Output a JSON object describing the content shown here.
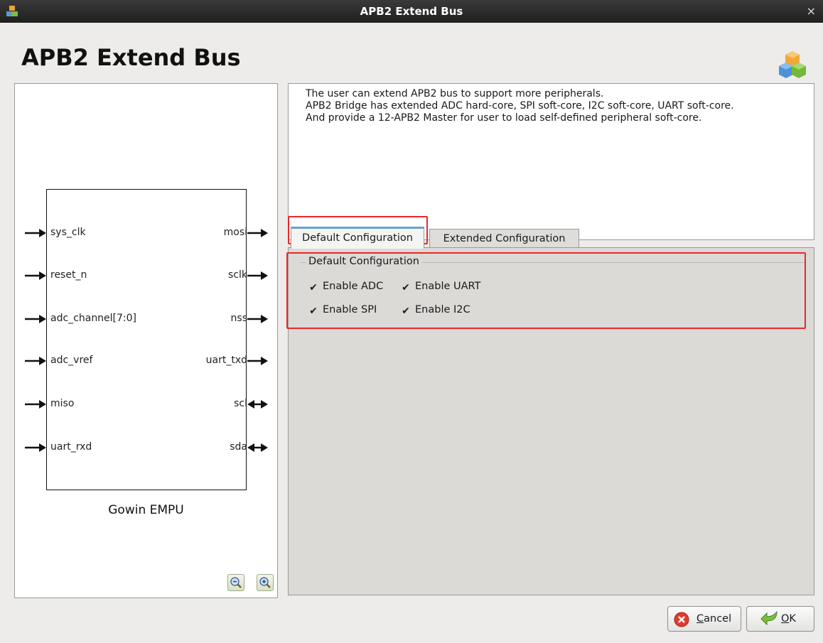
{
  "window": {
    "title": "APB2 Extend Bus",
    "close_glyph": "×"
  },
  "header": {
    "title": "APB2 Extend Bus"
  },
  "diagram": {
    "block_label": "Gowin EMPU",
    "inputs": [
      "sys_clk",
      "reset_n",
      "adc_channel[7:0]",
      "adc_vref",
      "miso",
      "uart_rxd"
    ],
    "outputs": [
      "mosi",
      "sclk",
      "nss",
      "uart_txd",
      "scl",
      "sda"
    ],
    "zoom_out_icon": "zoom-out-icon",
    "zoom_in_icon": "zoom-in-icon"
  },
  "description": {
    "lines": [
      "The user can extend APB2 bus to support more peripherals.",
      "APB2 Bridge has extended ADC hard-core, SPI soft-core, I2C soft-core, UART soft-core.",
      "And provide a 12-APB2 Master for user to load self-defined peripheral soft-core."
    ]
  },
  "tabs": {
    "default": "Default Configuration",
    "extended": "Extended Configuration"
  },
  "config": {
    "group_label": "Default Configuration",
    "options": [
      {
        "label": "Enable ADC",
        "checked": true
      },
      {
        "label": "Enable UART",
        "checked": true
      },
      {
        "label": "Enable SPI",
        "checked": true
      },
      {
        "label": "Enable I2C",
        "checked": true
      }
    ],
    "check_glyph": "✔"
  },
  "buttons": {
    "cancel_first": "C",
    "cancel_rest": "ancel",
    "ok_first": "O",
    "ok_rest": "K"
  },
  "colors": {
    "highlight": "#e8292c",
    "tab_accent": "#6aa0cc"
  }
}
